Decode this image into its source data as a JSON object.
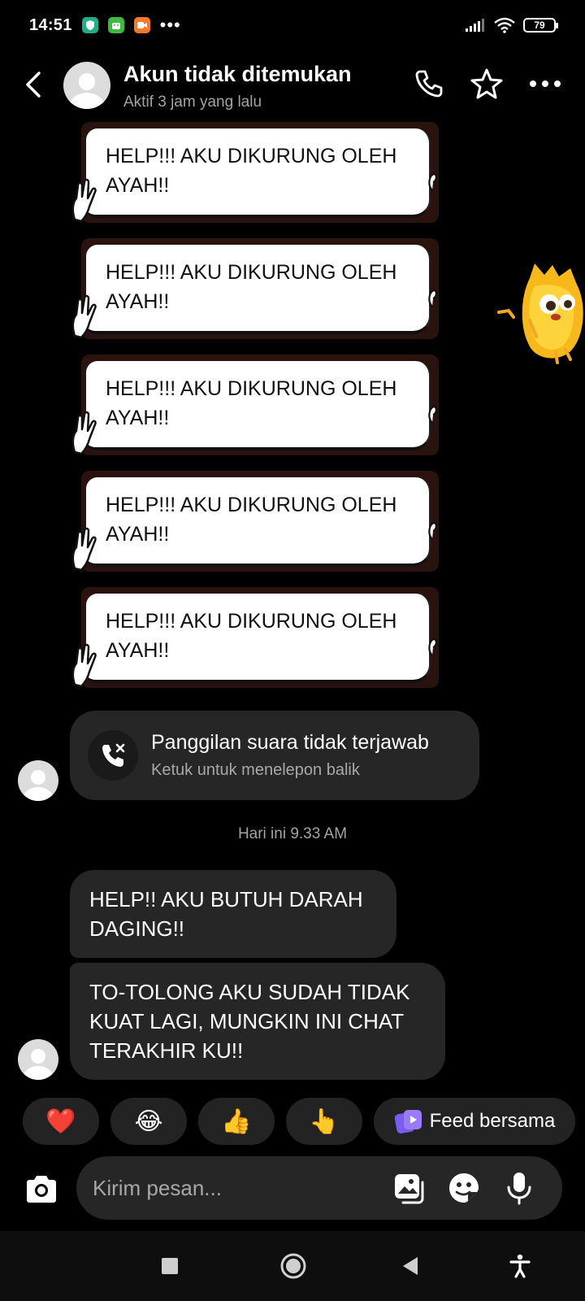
{
  "status_bar": {
    "time": "14:51",
    "battery": "79",
    "more": "•••"
  },
  "header": {
    "contact_name": "Akun tidak ditemukan",
    "contact_status": "Aktif 3 jam yang lalu"
  },
  "stickers": [
    {
      "text": "HELP!!! AKU DIKURUNG OLEH AYAH!!"
    },
    {
      "text": "HELP!!! AKU DIKURUNG OLEH AYAH!!"
    },
    {
      "text": "HELP!!! AKU DIKURUNG OLEH AYAH!!"
    },
    {
      "text": "HELP!!! AKU DIKURUNG OLEH AYAH!!"
    },
    {
      "text": "HELP!!! AKU DIKURUNG OLEH AYAH!!"
    }
  ],
  "missed_call": {
    "title": "Panggilan suara tidak terjawab",
    "subtitle": "Ketuk untuk menelepon balik"
  },
  "timestamp": "Hari ini 9.33 AM",
  "messages": [
    {
      "text": "HELP!! AKU BUTUH DARAH DAGING!!"
    },
    {
      "text": "TO-TOLONG AKU SUDAH TIDAK KUAT LAGI, MUNGKIN INI CHAT TERAKHIR KU!!"
    }
  ],
  "quick_reactions": [
    {
      "emoji": "❤️"
    },
    {
      "emoji": "😂"
    },
    {
      "emoji": "👍"
    },
    {
      "emoji": "👆"
    }
  ],
  "feed_button": {
    "label": "Feed bersama"
  },
  "composer": {
    "placeholder": "Kirim pesan..."
  },
  "colors": {
    "background": "#000000",
    "bubble": "#262626",
    "muted_text": "#a3a3a3",
    "feed_icon": "#7b5cf0"
  }
}
